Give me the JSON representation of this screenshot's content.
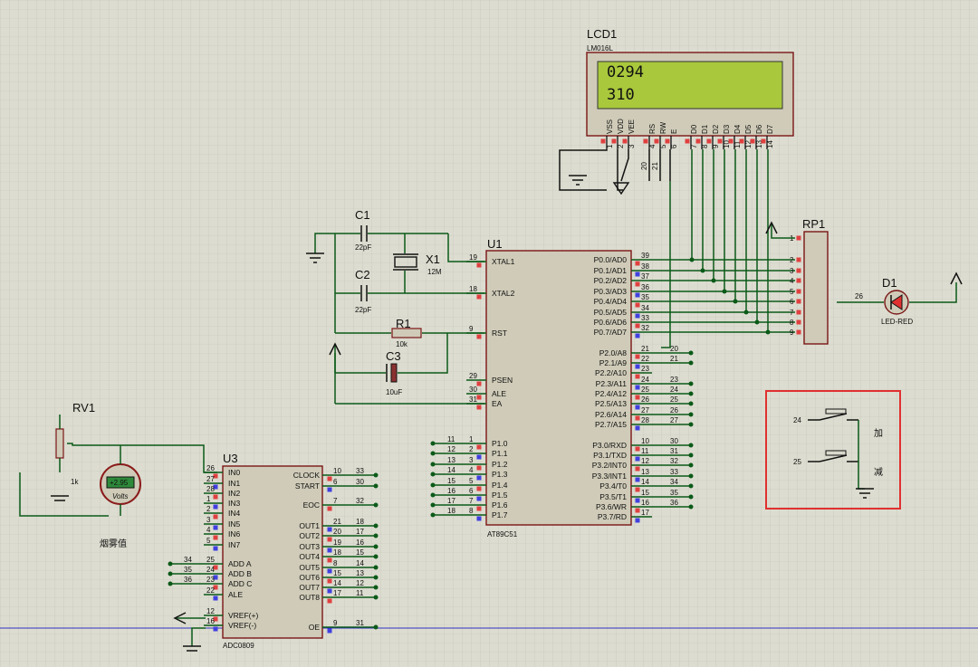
{
  "lcd": {
    "ref": "LCD1",
    "model": "LM016L",
    "line1": "0294",
    "line2": "310",
    "pins": [
      {
        "label": "VSS",
        "num": "1"
      },
      {
        "label": "VDD",
        "num": "2"
      },
      {
        "label": "VEE",
        "num": "3"
      },
      {
        "label": "RS",
        "num": "4"
      },
      {
        "label": "RW",
        "num": "5"
      },
      {
        "label": "E",
        "num": "6"
      },
      {
        "label": "D0",
        "num": "7"
      },
      {
        "label": "D1",
        "num": "8"
      },
      {
        "label": "D2",
        "num": "9"
      },
      {
        "label": "D3",
        "num": "10"
      },
      {
        "label": "D4",
        "num": "11"
      },
      {
        "label": "D5",
        "num": "12"
      },
      {
        "label": "D6",
        "num": "13"
      },
      {
        "label": "D7",
        "num": "14"
      }
    ],
    "net_labels": [
      "20",
      "21"
    ]
  },
  "caps": {
    "c1": {
      "ref": "C1",
      "value": "22pF"
    },
    "c2": {
      "ref": "C2",
      "value": "22pF"
    },
    "c3": {
      "ref": "C3",
      "value": "10uF"
    }
  },
  "crystal": {
    "ref": "X1",
    "value": "12M"
  },
  "resistor": {
    "ref": "R1",
    "value": "10k"
  },
  "mcu": {
    "ref": "U1",
    "model": "AT89C51",
    "left_pins": [
      {
        "label": "XTAL1",
        "num": "19"
      },
      {
        "label": "XTAL2",
        "num": "18"
      },
      {
        "label": "RST",
        "num": "9"
      },
      {
        "label": "PSEN",
        "num": "29"
      },
      {
        "label": "ALE",
        "num": "30"
      },
      {
        "label": "EA",
        "num": "31"
      },
      {
        "label": "P1.0",
        "num": "1",
        "net": "11"
      },
      {
        "label": "P1.1",
        "num": "2",
        "net": "12"
      },
      {
        "label": "P1.2",
        "num": "3",
        "net": "13"
      },
      {
        "label": "P1.3",
        "num": "4",
        "net": "14"
      },
      {
        "label": "P1.4",
        "num": "5",
        "net": "15"
      },
      {
        "label": "P1.5",
        "num": "6",
        "net": "16"
      },
      {
        "label": "P1.6",
        "num": "7",
        "net": "17"
      },
      {
        "label": "P1.7",
        "num": "8",
        "net": "18"
      }
    ],
    "right_pins": [
      {
        "label": "P0.0/AD0",
        "num": "39",
        "net": ""
      },
      {
        "label": "P0.1/AD1",
        "num": "38",
        "net": ""
      },
      {
        "label": "P0.2/AD2",
        "num": "37",
        "net": ""
      },
      {
        "label": "P0.3/AD3",
        "num": "36",
        "net": ""
      },
      {
        "label": "P0.4/AD4",
        "num": "35",
        "net": ""
      },
      {
        "label": "P0.5/AD5",
        "num": "34",
        "net": ""
      },
      {
        "label": "P0.6/AD6",
        "num": "33",
        "net": ""
      },
      {
        "label": "P0.7/AD7",
        "num": "32",
        "net": ""
      },
      {
        "label": "P2.0/A8",
        "num": "21",
        "net": "20"
      },
      {
        "label": "P2.1/A9",
        "num": "22",
        "net": "21"
      },
      {
        "label": "P2.2/A10",
        "num": "23",
        "net": ""
      },
      {
        "label": "P2.3/A11",
        "num": "24",
        "net": "23"
      },
      {
        "label": "P2.4/A12",
        "num": "25",
        "net": "24"
      },
      {
        "label": "P2.5/A13",
        "num": "26",
        "net": "25"
      },
      {
        "label": "P2.6/A14",
        "num": "27",
        "net": "26"
      },
      {
        "label": "P2.7/A15",
        "num": "28",
        "net": "27"
      },
      {
        "label": "P3.0/RXD",
        "num": "10",
        "net": "30"
      },
      {
        "label": "P3.1/TXD",
        "num": "11",
        "net": "31"
      },
      {
        "label": "P3.2/INT0",
        "num": "12",
        "net": "32"
      },
      {
        "label": "P3.3/INT1",
        "num": "13",
        "net": "33"
      },
      {
        "label": "P3.4/T0",
        "num": "14",
        "net": "34"
      },
      {
        "label": "P3.5/T1",
        "num": "15",
        "net": "35"
      },
      {
        "label": "P3.6/WR",
        "num": "16",
        "net": "36"
      },
      {
        "label": "P3.7/RD",
        "num": "17",
        "net": ""
      }
    ]
  },
  "rp1": {
    "ref": "RP1",
    "pins": [
      "1",
      "2",
      "3",
      "4",
      "5",
      "6",
      "7",
      "8",
      "9"
    ]
  },
  "led": {
    "ref": "D1",
    "value": "LED-RED",
    "net": "26"
  },
  "keys": {
    "k1": {
      "net": "24",
      "label": "加"
    },
    "k2": {
      "net": "25",
      "label": "减"
    }
  },
  "pot": {
    "ref": "RV1",
    "value": "1k"
  },
  "meter": {
    "reading": "+2.95",
    "unit": "Volts",
    "caption": "烟雾值"
  },
  "adc": {
    "ref": "U3",
    "model": "ADC0809",
    "left_pins": [
      {
        "label": "IN0",
        "num": "26",
        "net": ""
      },
      {
        "label": "IN1",
        "num": "27",
        "net": ""
      },
      {
        "label": "IN2",
        "num": "28",
        "net": ""
      },
      {
        "label": "IN3",
        "num": "1",
        "net": ""
      },
      {
        "label": "IN4",
        "num": "2",
        "net": ""
      },
      {
        "label": "IN5",
        "num": "3",
        "net": ""
      },
      {
        "label": "IN6",
        "num": "4",
        "net": ""
      },
      {
        "label": "IN7",
        "num": "5",
        "net": ""
      },
      {
        "label": "ADD A",
        "num": "25",
        "net": "34"
      },
      {
        "label": "ADD B",
        "num": "24",
        "net": "35"
      },
      {
        "label": "ADD C",
        "num": "23",
        "net": "36"
      },
      {
        "label": "ALE",
        "num": "22",
        "net": ""
      },
      {
        "label": "VREF(+)",
        "num": "12",
        "net": ""
      },
      {
        "label": "VREF(-)",
        "num": "16",
        "net": ""
      }
    ],
    "right_pins": [
      {
        "label": "CLOCK",
        "num": "10",
        "net": "33"
      },
      {
        "label": "START",
        "num": "6",
        "net": "30"
      },
      {
        "label": "EOC",
        "num": "7",
        "net": "32"
      },
      {
        "label": "OUT1",
        "num": "21",
        "net": "18"
      },
      {
        "label": "OUT2",
        "num": "20",
        "net": "17"
      },
      {
        "label": "OUT3",
        "num": "19",
        "net": "16"
      },
      {
        "label": "OUT4",
        "num": "18",
        "net": "15"
      },
      {
        "label": "OUT5",
        "num": "8",
        "net": "14"
      },
      {
        "label": "OUT6",
        "num": "15",
        "net": "13"
      },
      {
        "label": "OUT7",
        "num": "14",
        "net": "12"
      },
      {
        "label": "OUT8",
        "num": "17",
        "net": "11"
      },
      {
        "label": "OE",
        "num": "9",
        "net": "31"
      }
    ]
  },
  "colors": {
    "background": "#dcdcd0",
    "wire": "#0b5a18",
    "body": "#7a1515",
    "lcd_screen": "#a9c83c",
    "highlight": "#e03030"
  }
}
